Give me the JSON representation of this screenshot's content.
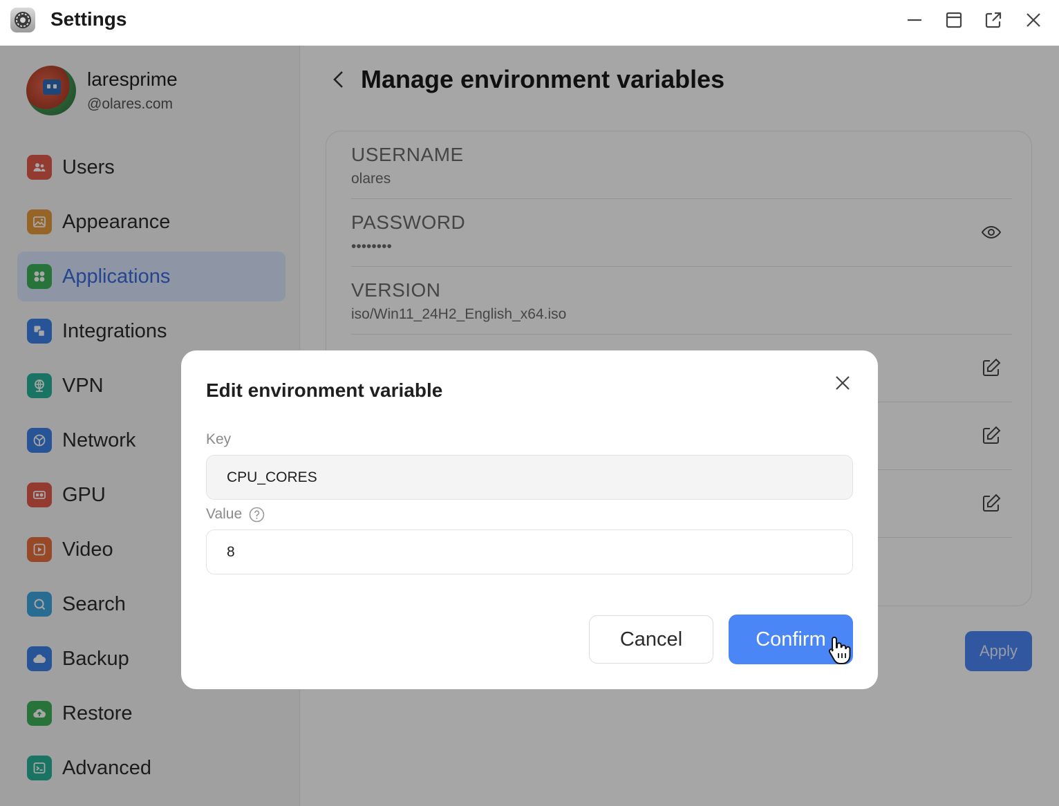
{
  "window": {
    "title": "Settings",
    "controls": [
      "minimize",
      "maximize",
      "pop-out",
      "close"
    ]
  },
  "profile": {
    "name": "laresprime",
    "domain": "@olares.com"
  },
  "sidebar": {
    "items": [
      {
        "label": "Users",
        "icon": "users-icon",
        "color": "#e25b4b",
        "active": false
      },
      {
        "label": "Appearance",
        "icon": "image-icon",
        "color": "#e89a3c",
        "active": false
      },
      {
        "label": "Applications",
        "icon": "apps-icon",
        "color": "#3db158",
        "active": true
      },
      {
        "label": "Integrations",
        "icon": "integrations-icon",
        "color": "#3c82e8",
        "active": false
      },
      {
        "label": "VPN",
        "icon": "globe-icon",
        "color": "#27b39a",
        "active": false
      },
      {
        "label": "Network",
        "icon": "network-icon",
        "color": "#3c82e8",
        "active": false
      },
      {
        "label": "GPU",
        "icon": "gpu-icon",
        "color": "#e25b4b",
        "active": false
      },
      {
        "label": "Video",
        "icon": "play-icon",
        "color": "#e8713c",
        "active": false
      },
      {
        "label": "Search",
        "icon": "search-icon",
        "color": "#3ea6e0",
        "active": false
      },
      {
        "label": "Backup",
        "icon": "cloud-icon",
        "color": "#3c82e8",
        "active": false
      },
      {
        "label": "Restore",
        "icon": "cloud-upload-icon",
        "color": "#3db158",
        "active": false
      },
      {
        "label": "Advanced",
        "icon": "terminal-icon",
        "color": "#27b39a",
        "active": false
      }
    ]
  },
  "page": {
    "title": "Manage environment variables",
    "variables": [
      {
        "key": "USERNAME",
        "value": "olares",
        "action": "none"
      },
      {
        "key": "PASSWORD",
        "value": "••••••••",
        "action": "eye-icon"
      },
      {
        "key": "VERSION",
        "value": "iso/Win11_24H2_English_x64.iso",
        "action": "none"
      },
      {
        "key": "",
        "value": "",
        "action": "edit-icon"
      },
      {
        "key": "",
        "value": "",
        "action": "edit-icon"
      },
      {
        "key": "",
        "value": "",
        "action": "edit-icon"
      }
    ],
    "apply_label": "Apply"
  },
  "dialog": {
    "title": "Edit environment variable",
    "key_label": "Key",
    "key_value": "CPU_CORES",
    "value_label": "Value",
    "value_value": "8",
    "cancel_label": "Cancel",
    "confirm_label": "Confirm"
  },
  "colors": {
    "accent": "#4a86f5",
    "active_nav_bg": "#dbe6ff",
    "active_nav_text": "#3a6bdb"
  }
}
